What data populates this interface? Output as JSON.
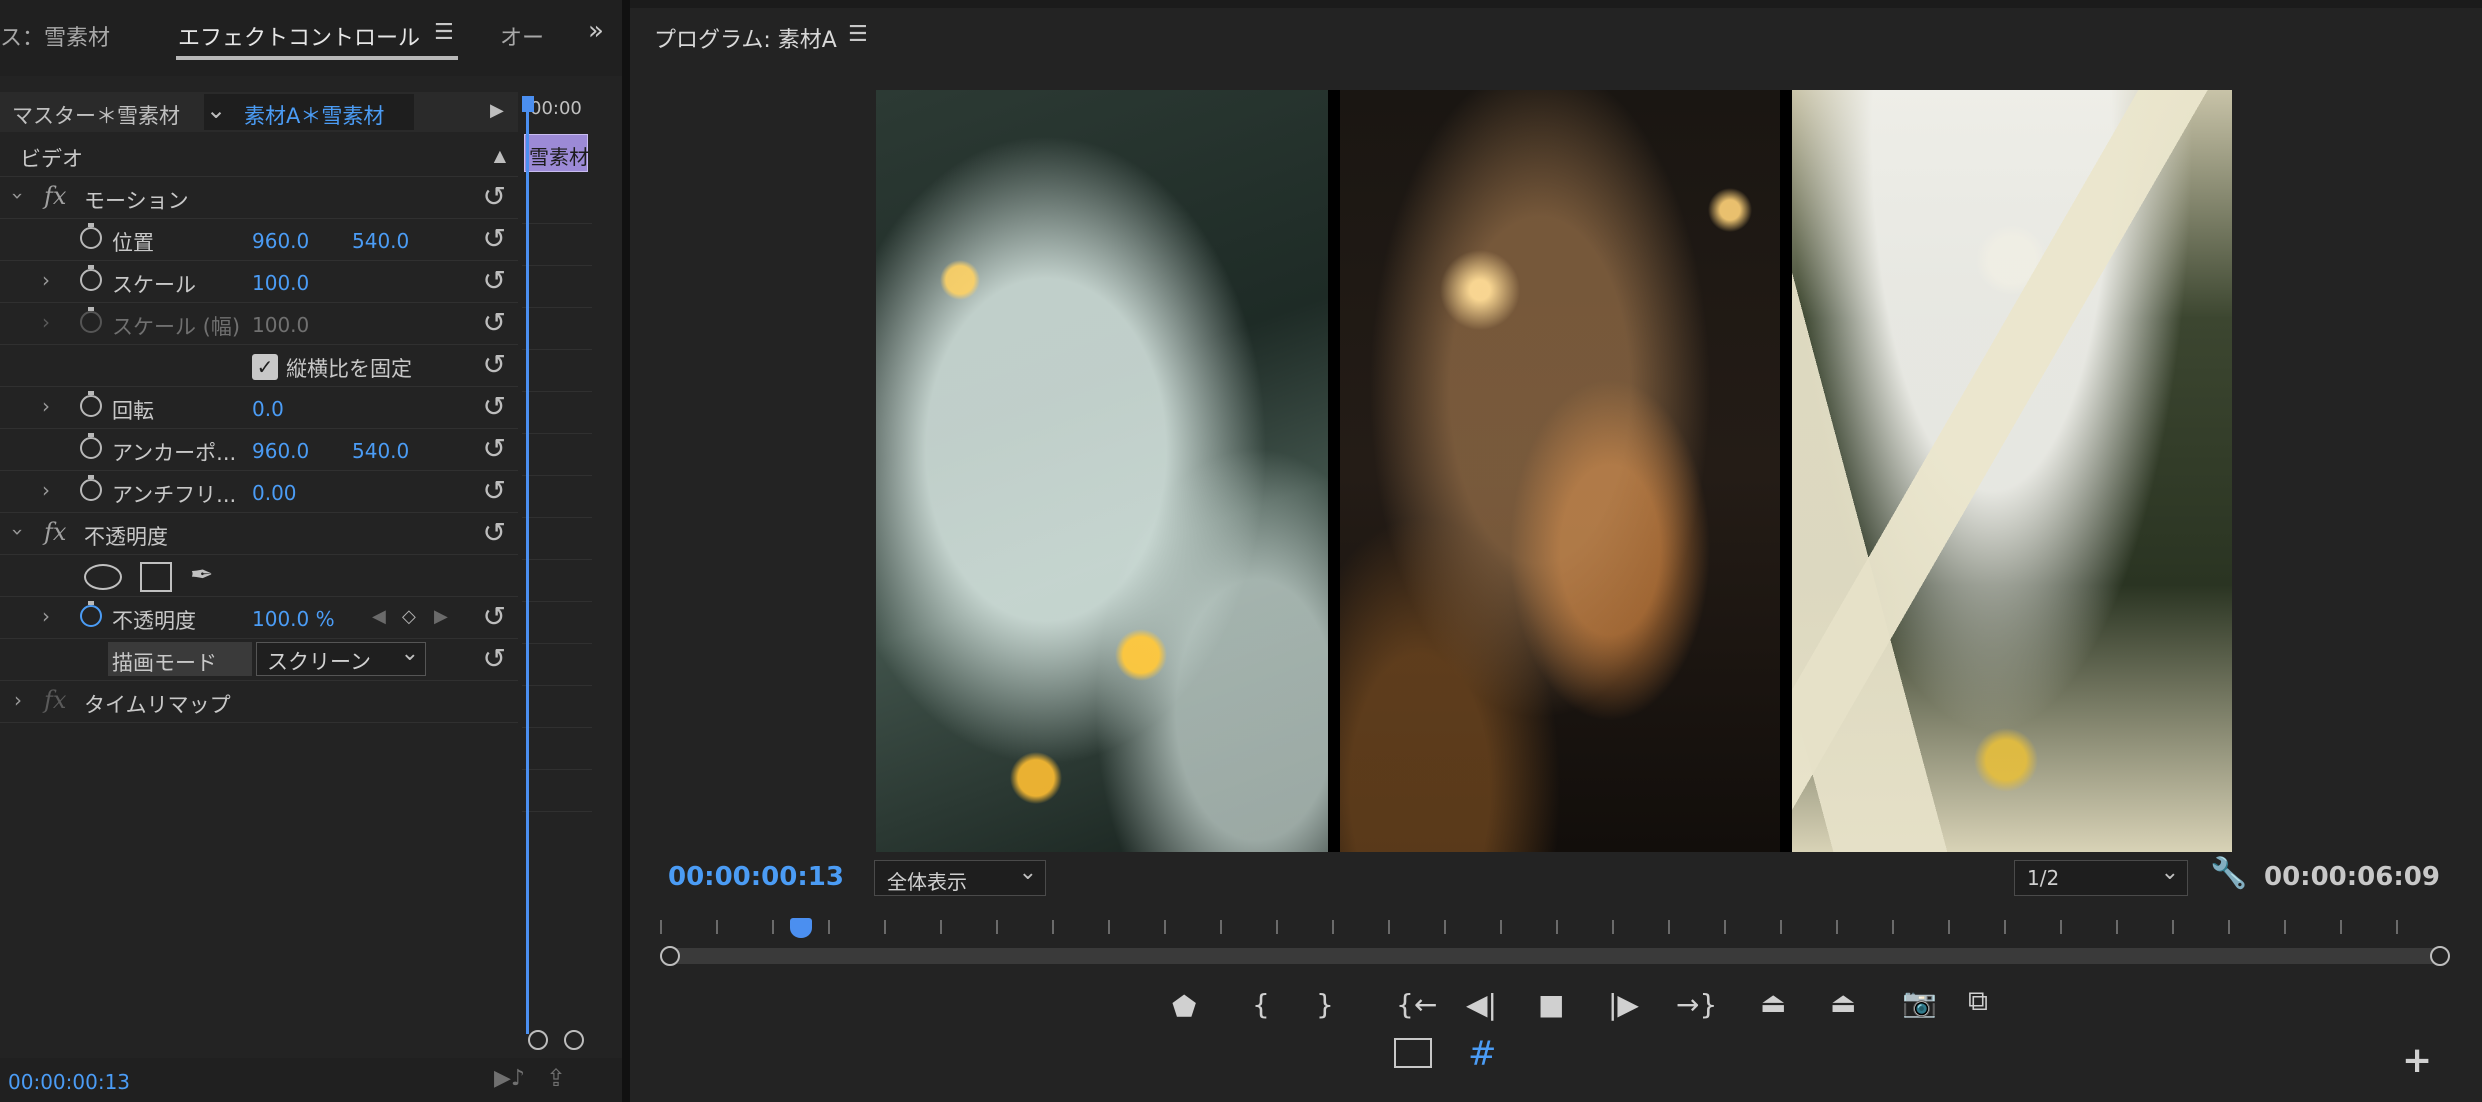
{
  "left_panel": {
    "tabs": [
      "ス：雪素材",
      "エフェクトコントロール",
      "オー"
    ],
    "header": {
      "master": "マスター＊雪素材",
      "clip": "素材A＊雪素材",
      "timecode": "00:00",
      "clip_block": "雪素材"
    },
    "section_video": "ビデオ",
    "motion": {
      "title": "モーション",
      "position": {
        "label": "位置",
        "x": "960.0",
        "y": "540.0"
      },
      "scale": {
        "label": "スケール",
        "value": "100.0"
      },
      "scale_width": {
        "label": "スケール (幅)",
        "value": "100.0"
      },
      "uniform": {
        "label": "縦横比を固定"
      },
      "rotation": {
        "label": "回転",
        "value": "0.0"
      },
      "anchor": {
        "label": "アンカーポ...",
        "x": "960.0",
        "y": "540.0"
      },
      "antiflicker": {
        "label": "アンチフリ...",
        "value": "0.00"
      }
    },
    "opacity": {
      "title": "不透明度",
      "row_label": "不透明度",
      "value": "100.0 %",
      "blend_label": "描画モード",
      "blend_value": "スクリーン"
    },
    "time_remap": {
      "title": "タイムリマップ"
    },
    "footer_timecode": "00:00:00:13"
  },
  "monitor": {
    "title": "プログラム: 素材A",
    "current_timecode": "00:00:00:13",
    "zoom": "全体表示",
    "resolution": "1/2",
    "duration_timecode": "00:00:06:09"
  },
  "icons": {
    "menu": "☰",
    "overflow": "»",
    "play": "▶",
    "reset": "↺",
    "chevron_right": "›",
    "chevron_down": "⌄",
    "collapse_up": "▲",
    "check": "✓",
    "marker": "⬟",
    "mark_in": "{",
    "mark_out": "}",
    "goto_in": "{←",
    "step_back": "◀|",
    "stop": "■",
    "step_fwd": "|▶",
    "goto_out": "→}",
    "lift": "⏏",
    "extract": "⏏",
    "camera": "📷",
    "compare": "⧉",
    "safe": "▭",
    "grid": "#",
    "plus": "+",
    "pen": "✒"
  },
  "colors": {
    "accent": "#4b9cf5",
    "bg": "#232323"
  }
}
